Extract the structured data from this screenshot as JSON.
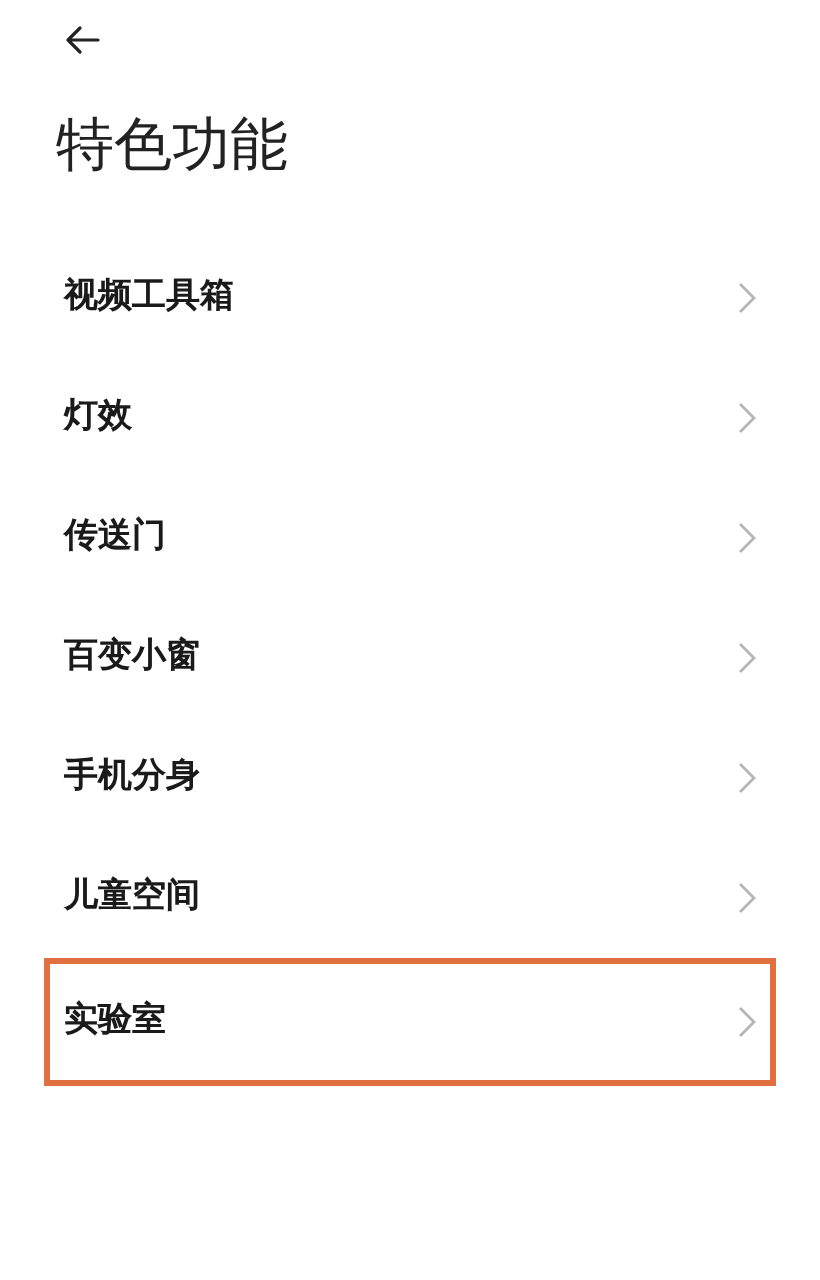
{
  "title": "特色功能",
  "items": [
    {
      "label": "视频工具箱",
      "highlighted": false
    },
    {
      "label": "灯效",
      "highlighted": false
    },
    {
      "label": "传送门",
      "highlighted": false
    },
    {
      "label": "百变小窗",
      "highlighted": false
    },
    {
      "label": "手机分身",
      "highlighted": false
    },
    {
      "label": "儿童空间",
      "highlighted": false
    },
    {
      "label": "实验室",
      "highlighted": true
    }
  ]
}
